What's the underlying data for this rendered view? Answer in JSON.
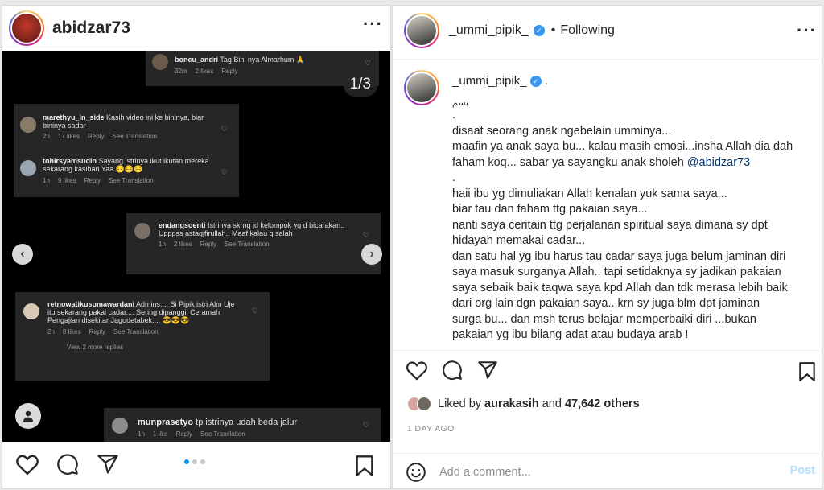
{
  "left_post": {
    "username": "abidzar73",
    "counter": "1/3",
    "comments": [
      {
        "user": "boncu_andri",
        "text": "Tag Bini nya Almarhum 🙏",
        "time": "32m",
        "likes": "2 likes",
        "reply": "Reply"
      },
      {
        "user": "marethyu_in_side",
        "text": "Kasih video ini ke bininya, biar bininya sadar",
        "time": "2h",
        "likes": "17 likes",
        "reply": "Reply",
        "translate": "See Translation"
      },
      {
        "user": "tohirsyamsudin",
        "text": "Sayang istrinya ikut ikutan mereka sekarang kasihan Yaa 😔😔😔",
        "time": "1h",
        "likes": "9 likes",
        "reply": "Reply",
        "translate": "See Translation"
      },
      {
        "user": "endangsoenti",
        "text": "Istrinya skrng jd kelompok yg d bicarakan.. Upppss astagjfirullah.. Maaf kalau q salah",
        "time": "1h",
        "likes": "2 likes",
        "reply": "Reply",
        "translate": "See Translation"
      },
      {
        "user": "retnowatikusumawardani",
        "text": "Admins.... Si Pipik istri Alm Uje itu sekarang pakai cadar.... Sering dipanggil Ceramah Pengajian disekitar Jagodetabek.... 😎😎😎",
        "time": "2h",
        "likes": "8 likes",
        "reply": "Reply",
        "translate": "See Translation",
        "view_replies": "View 2 more replies"
      },
      {
        "user": "munprasetyo",
        "text": "tp istrinya udah beda jalur",
        "time": "1h",
        "likes": "1 like",
        "reply": "Reply",
        "translate": "See Translation"
      }
    ]
  },
  "right_post": {
    "username": "_ummi_pipik_",
    "verified_mark": "✓",
    "separator": "•",
    "following": "Following",
    "caption_user": "_ummi_pipik_",
    "caption_suffix": ".",
    "caption_arabic": "بسم",
    "caption_lines": [
      ".",
      "disaat seorang anak ngebelain umminya...",
      "maafin ya anak saya bu... kalau masih emosi...insha Allah dia dah",
      "faham koq... sabar ya sayangku anak sholeh ",
      ".",
      "haii ibu yg dimuliakan Allah kenalan yuk sama saya...",
      "biar tau dan faham ttg pakaian saya...",
      "nanti saya ceritain ttg perjalanan spiritual saya dimana sy dpt",
      "hidayah memakai cadar...",
      "dan satu hal yg ibu harus tau cadar saya juga belum jaminan diri",
      "saya masuk surganya Allah.. tapi setidaknya sy jadikan pakaian",
      "saya sebaik baik taqwa saya kpd Allah dan tdk merasa lebih baik",
      "dari org lain dgn pakaian saya.. krn sy juga blm dpt jaminan",
      "surga bu... dan msh terus belajar memperbaiki diri ...bukan",
      "pakaian yg ibu bilang adat atau budaya arab !"
    ],
    "mention": "@abidzar73",
    "likes_prefix": "Liked by",
    "liked_by": "aurakasih",
    "likes_and": "and",
    "likes_count": "47,642 others",
    "timestamp": "1 DAY AGO",
    "comment_placeholder": "Add a comment...",
    "post_label": "Post"
  },
  "colors": {
    "accent": "#0095f6",
    "verified": "#3897f0",
    "mention": "#00376b"
  }
}
